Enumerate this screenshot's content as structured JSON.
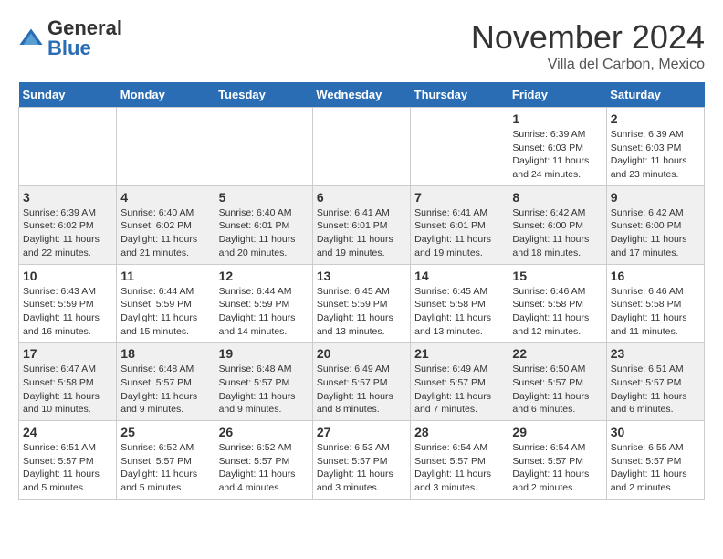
{
  "logo": {
    "general": "General",
    "blue": "Blue"
  },
  "header": {
    "month": "November 2024",
    "location": "Villa del Carbon, Mexico"
  },
  "weekdays": [
    "Sunday",
    "Monday",
    "Tuesday",
    "Wednesday",
    "Thursday",
    "Friday",
    "Saturday"
  ],
  "weeks": [
    [
      {
        "day": "",
        "info": ""
      },
      {
        "day": "",
        "info": ""
      },
      {
        "day": "",
        "info": ""
      },
      {
        "day": "",
        "info": ""
      },
      {
        "day": "",
        "info": ""
      },
      {
        "day": "1",
        "info": "Sunrise: 6:39 AM\nSunset: 6:03 PM\nDaylight: 11 hours and 24 minutes."
      },
      {
        "day": "2",
        "info": "Sunrise: 6:39 AM\nSunset: 6:03 PM\nDaylight: 11 hours and 23 minutes."
      }
    ],
    [
      {
        "day": "3",
        "info": "Sunrise: 6:39 AM\nSunset: 6:02 PM\nDaylight: 11 hours and 22 minutes."
      },
      {
        "day": "4",
        "info": "Sunrise: 6:40 AM\nSunset: 6:02 PM\nDaylight: 11 hours and 21 minutes."
      },
      {
        "day": "5",
        "info": "Sunrise: 6:40 AM\nSunset: 6:01 PM\nDaylight: 11 hours and 20 minutes."
      },
      {
        "day": "6",
        "info": "Sunrise: 6:41 AM\nSunset: 6:01 PM\nDaylight: 11 hours and 19 minutes."
      },
      {
        "day": "7",
        "info": "Sunrise: 6:41 AM\nSunset: 6:01 PM\nDaylight: 11 hours and 19 minutes."
      },
      {
        "day": "8",
        "info": "Sunrise: 6:42 AM\nSunset: 6:00 PM\nDaylight: 11 hours and 18 minutes."
      },
      {
        "day": "9",
        "info": "Sunrise: 6:42 AM\nSunset: 6:00 PM\nDaylight: 11 hours and 17 minutes."
      }
    ],
    [
      {
        "day": "10",
        "info": "Sunrise: 6:43 AM\nSunset: 5:59 PM\nDaylight: 11 hours and 16 minutes."
      },
      {
        "day": "11",
        "info": "Sunrise: 6:44 AM\nSunset: 5:59 PM\nDaylight: 11 hours and 15 minutes."
      },
      {
        "day": "12",
        "info": "Sunrise: 6:44 AM\nSunset: 5:59 PM\nDaylight: 11 hours and 14 minutes."
      },
      {
        "day": "13",
        "info": "Sunrise: 6:45 AM\nSunset: 5:59 PM\nDaylight: 11 hours and 13 minutes."
      },
      {
        "day": "14",
        "info": "Sunrise: 6:45 AM\nSunset: 5:58 PM\nDaylight: 11 hours and 13 minutes."
      },
      {
        "day": "15",
        "info": "Sunrise: 6:46 AM\nSunset: 5:58 PM\nDaylight: 11 hours and 12 minutes."
      },
      {
        "day": "16",
        "info": "Sunrise: 6:46 AM\nSunset: 5:58 PM\nDaylight: 11 hours and 11 minutes."
      }
    ],
    [
      {
        "day": "17",
        "info": "Sunrise: 6:47 AM\nSunset: 5:58 PM\nDaylight: 11 hours and 10 minutes."
      },
      {
        "day": "18",
        "info": "Sunrise: 6:48 AM\nSunset: 5:57 PM\nDaylight: 11 hours and 9 minutes."
      },
      {
        "day": "19",
        "info": "Sunrise: 6:48 AM\nSunset: 5:57 PM\nDaylight: 11 hours and 9 minutes."
      },
      {
        "day": "20",
        "info": "Sunrise: 6:49 AM\nSunset: 5:57 PM\nDaylight: 11 hours and 8 minutes."
      },
      {
        "day": "21",
        "info": "Sunrise: 6:49 AM\nSunset: 5:57 PM\nDaylight: 11 hours and 7 minutes."
      },
      {
        "day": "22",
        "info": "Sunrise: 6:50 AM\nSunset: 5:57 PM\nDaylight: 11 hours and 6 minutes."
      },
      {
        "day": "23",
        "info": "Sunrise: 6:51 AM\nSunset: 5:57 PM\nDaylight: 11 hours and 6 minutes."
      }
    ],
    [
      {
        "day": "24",
        "info": "Sunrise: 6:51 AM\nSunset: 5:57 PM\nDaylight: 11 hours and 5 minutes."
      },
      {
        "day": "25",
        "info": "Sunrise: 6:52 AM\nSunset: 5:57 PM\nDaylight: 11 hours and 5 minutes."
      },
      {
        "day": "26",
        "info": "Sunrise: 6:52 AM\nSunset: 5:57 PM\nDaylight: 11 hours and 4 minutes."
      },
      {
        "day": "27",
        "info": "Sunrise: 6:53 AM\nSunset: 5:57 PM\nDaylight: 11 hours and 3 minutes."
      },
      {
        "day": "28",
        "info": "Sunrise: 6:54 AM\nSunset: 5:57 PM\nDaylight: 11 hours and 3 minutes."
      },
      {
        "day": "29",
        "info": "Sunrise: 6:54 AM\nSunset: 5:57 PM\nDaylight: 11 hours and 2 minutes."
      },
      {
        "day": "30",
        "info": "Sunrise: 6:55 AM\nSunset: 5:57 PM\nDaylight: 11 hours and 2 minutes."
      }
    ]
  ]
}
